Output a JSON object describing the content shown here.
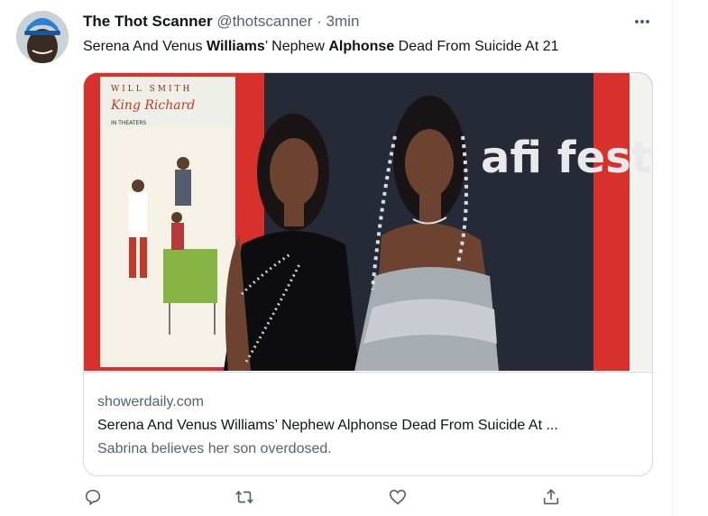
{
  "tweet": {
    "display_name": "The Thot Scanner",
    "handle": "@thotscanner",
    "separator": "·",
    "time": "3min",
    "text_parts": [
      {
        "t": "Serena And Venus ",
        "bold": false
      },
      {
        "t": "Williams",
        "bold": true
      },
      {
        "t": "’ Nephew ",
        "bold": false
      },
      {
        "t": "Alphonse",
        "bold": true
      },
      {
        "t": " Dead From Suicide At 21",
        "bold": false
      }
    ]
  },
  "card": {
    "domain": "showerdaily.com",
    "title": "Serena And Venus Williams’ Nephew Alphonse Dead From Suicide At ...",
    "description": "Sabrina believes her son overdosed.",
    "poster": {
      "top_line": "WILL SMITH",
      "title": "King Richard",
      "tagline": "IN THEATERS"
    },
    "backdrop_text": "afi fest"
  },
  "actions": [
    "reply-icon",
    "retweet-icon",
    "like-icon",
    "share-icon"
  ],
  "colors": {
    "text": "#0f1419",
    "secondary": "#536471",
    "border": "#cfd9de",
    "red_frame": "#d8302a",
    "backdrop": "#252a36"
  }
}
